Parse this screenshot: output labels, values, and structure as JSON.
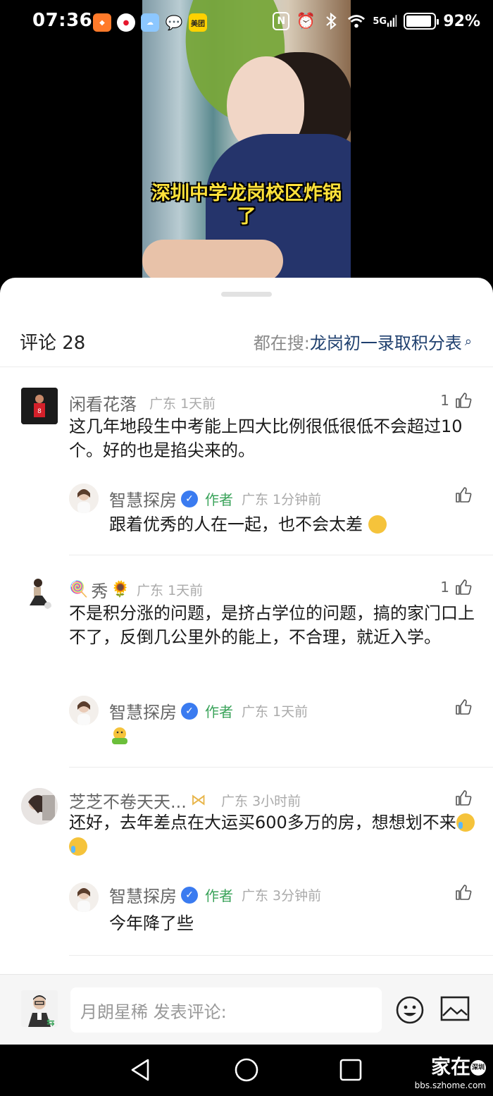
{
  "status_bar": {
    "time": "07:36",
    "battery": "92%",
    "network": "5G",
    "battery_level": 0.92,
    "app_icons": [
      "taobao-icon",
      "weibo-icon",
      "weather-icon",
      "wechat-icon",
      "meituan-icon"
    ],
    "meituan_label": "美团",
    "system_icons": [
      "nfc-icon",
      "alarm-icon",
      "bluetooth-icon",
      "wifi-icon",
      "signal-icon",
      "battery-icon"
    ]
  },
  "video": {
    "caption": "深圳中学龙岗校区炸锅了"
  },
  "comments_header": {
    "title": "评论 28",
    "search_prefix": "都在搜:",
    "search_term": "龙岗初一录取积分表"
  },
  "comments": [
    {
      "username": "闲看花落",
      "location": "广东",
      "time": "1天前",
      "likes": "1",
      "text": "这几年地段生中考能上四大比例很低很低不会超过10个。好的也是掐尖来的。",
      "reply": {
        "username": "智慧探房",
        "tag": "作者",
        "location": "广东",
        "time": "1分钟前",
        "text": "跟着优秀的人在一起，也不会太差"
      }
    },
    {
      "username": "秀",
      "location": "广东",
      "time": "1天前",
      "likes": "1",
      "text": "不是积分涨的问题，是挤占学位的问题，搞的家门口上不了，反倒几公里外的能上，不合理，就近入学。",
      "reply": {
        "username": "智慧探房",
        "tag": "作者",
        "location": "广东",
        "time": "1天前",
        "text": ""
      }
    },
    {
      "username": "芝芝不卷天天...",
      "location": "广东",
      "time": "3小时前",
      "likes": "",
      "text": "还好，去年差点在大运买600多万的房，想想划不来",
      "reply": {
        "username": "智慧探房",
        "tag": "作者",
        "location": "广东",
        "time": "3分钟前",
        "text": "今年降了些"
      }
    }
  ],
  "input_bar": {
    "placeholder": "月朗星稀 发表评论:"
  },
  "watermark": {
    "main": "家在",
    "seal": "深圳",
    "site": "bbs.szhome.com"
  }
}
